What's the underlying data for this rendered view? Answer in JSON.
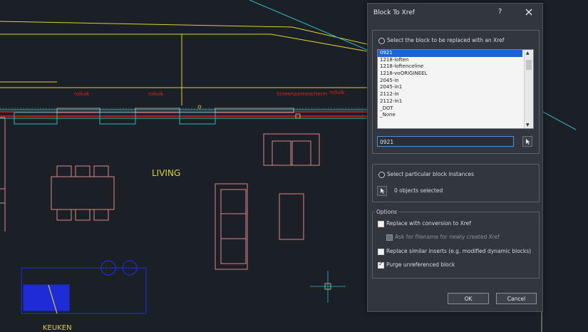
{
  "drawing": {
    "labels": {
      "living": "LIVING",
      "keuken": "KEUKEN",
      "red1": "rolluik",
      "red2": "rolluik",
      "red3": "Screenzonnescherm",
      "red4": "rolluik"
    },
    "colors": {
      "background": "#1b1f26",
      "yellow": "#d9d42a",
      "red": "#d9261c",
      "cyan": "#2fb8c4",
      "blue": "#1f2bd6",
      "pink": "#d98a8a"
    }
  },
  "dialog": {
    "title": "Block To Xref",
    "help_label": "?",
    "block_section": {
      "radio_label": "Select the block to be replaced with an Xref",
      "list_items": [
        "0921",
        "1218-loften",
        "1218-loftenceline",
        "1218-voORIGINEEL",
        "2045-in",
        "2045-in1",
        "2112-in",
        "2112-in1",
        "_DOT",
        "_None"
      ],
      "selected_index": 0,
      "name_value": "0921"
    },
    "instances_section": {
      "radio_label": "Select particular block instances",
      "objects_status": "0 objects selected"
    },
    "options_section": {
      "legend": "Options",
      "options": [
        {
          "label": "Replace with conversion to Xref",
          "checked": false
        },
        {
          "label": "Ask for filename for newly created Xref",
          "checked": false,
          "disabled": true
        },
        {
          "label": "Replace similar inserts (e.g. modified dynamic blocks)",
          "checked": false
        },
        {
          "label": "Purge unreferenced block",
          "checked": true
        }
      ]
    },
    "buttons": {
      "ok": "OK",
      "cancel": "Cancel"
    }
  }
}
